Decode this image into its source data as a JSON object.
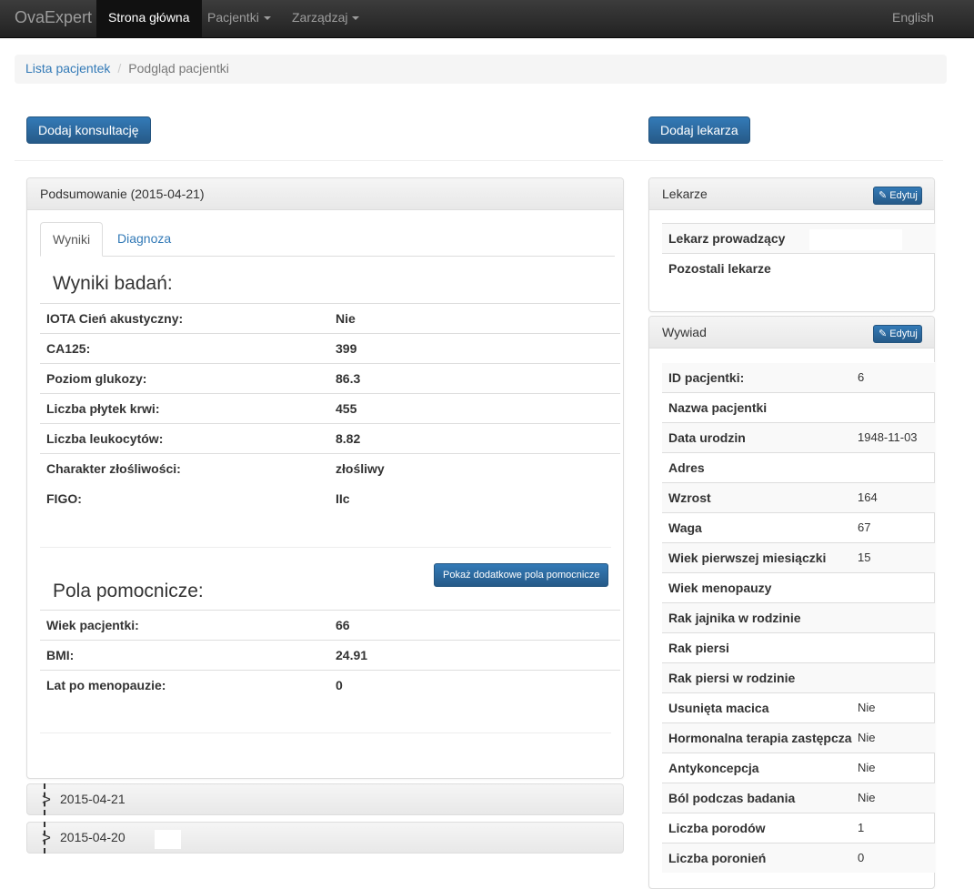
{
  "navbar": {
    "brand": "OvaExpert",
    "items": [
      {
        "label": "Strona główna"
      },
      {
        "label": "Pacjentki"
      },
      {
        "label": "Zarządzaj"
      }
    ],
    "language": "English"
  },
  "breadcrumb": {
    "link": "Lista pacjentek",
    "separator": "/",
    "current": "Podgląd pacjentki"
  },
  "actions": {
    "add_consultation": "Dodaj konsultację",
    "add_doctor": "Dodaj lekarza"
  },
  "summary": {
    "title": "Podsumowanie (2015-04-21)",
    "tabs": [
      {
        "label": "Wyniki",
        "active": true
      },
      {
        "label": "Diagnoza",
        "active": false
      }
    ],
    "results_title": "Wyniki badań:",
    "results": [
      {
        "label": "IOTA Cień akustyczny:",
        "value": "Nie"
      },
      {
        "label": "CA125:",
        "value": "399"
      },
      {
        "label": "Poziom glukozy:",
        "value": "86.3"
      },
      {
        "label": "Liczba płytek krwi:",
        "value": "455"
      },
      {
        "label": "Liczba leukocytów:",
        "value": "8.82"
      },
      {
        "label": "Charakter złośliwości:",
        "value": "złośliwy"
      },
      {
        "label": "FIGO:",
        "value": "IIc"
      }
    ],
    "show_more_button": "Pokaż dodatkowe pola pomocnicze",
    "helper_title": "Pola pomocnicze:",
    "helpers": [
      {
        "label": "Wiek pacjentki:",
        "value": "66"
      },
      {
        "label": "BMI:",
        "value": "24.91"
      },
      {
        "label": "Lat po menopauzie:",
        "value": "0"
      }
    ]
  },
  "consultations": [
    {
      "date": "2015-04-21"
    },
    {
      "date": "2015-04-20"
    }
  ],
  "doctors": {
    "title": "Lekarze",
    "edit_label": "Edytuj",
    "rows": [
      {
        "label": "Lekarz prowadzący",
        "value": ""
      },
      {
        "label": "Pozostali lekarze",
        "value": ""
      }
    ]
  },
  "interview": {
    "title": "Wywiad",
    "edit_label": "Edytuj",
    "rows": [
      {
        "label": "ID pacjentki:",
        "value": "6"
      },
      {
        "label": "Nazwa pacjentki",
        "value": ""
      },
      {
        "label": "Data urodzin",
        "value": "1948-11-03"
      },
      {
        "label": "Adres",
        "value": ""
      },
      {
        "label": "Wzrost",
        "value": "164"
      },
      {
        "label": "Waga",
        "value": "67"
      },
      {
        "label": "Wiek pierwszej miesiączki",
        "value": "15"
      },
      {
        "label": "Wiek menopauzy",
        "value": ""
      },
      {
        "label": "Rak jajnika w rodzinie",
        "value": ""
      },
      {
        "label": "Rak piersi",
        "value": ""
      },
      {
        "label": "Rak piersi w rodzinie",
        "value": ""
      },
      {
        "label": "Usunięta macica",
        "value": "Nie"
      },
      {
        "label": "Hormonalna terapia zastępcza",
        "value": "Nie"
      },
      {
        "label": "Antykoncepcja",
        "value": "Nie"
      },
      {
        "label": "Ból podczas badania",
        "value": "Nie"
      },
      {
        "label": "Liczba porodów",
        "value": "1"
      },
      {
        "label": "Liczba poronień",
        "value": "0"
      }
    ]
  },
  "colors": {
    "primary": "#337ab7",
    "navbar": "#222222"
  }
}
